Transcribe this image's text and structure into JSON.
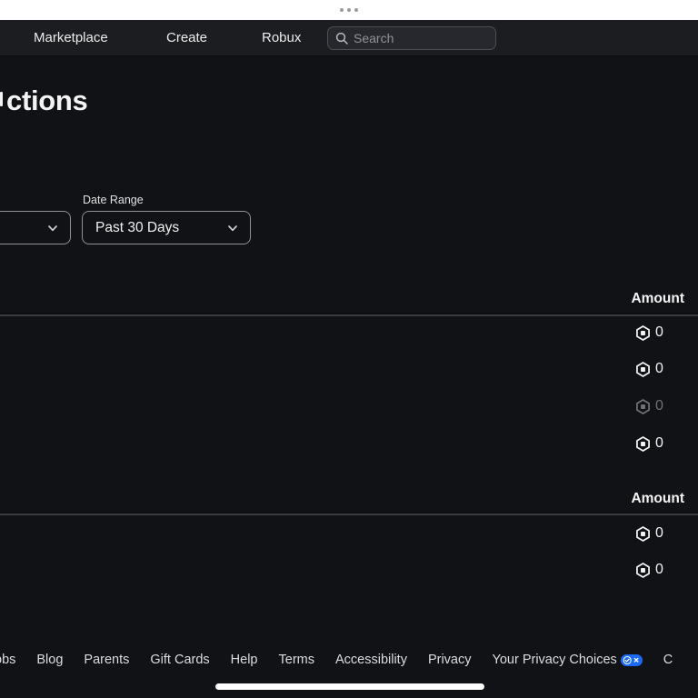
{
  "nav": {
    "items": [
      {
        "label": "Marketplace"
      },
      {
        "label": "Create"
      },
      {
        "label": "Robux"
      }
    ],
    "search": {
      "placeholder": "Search"
    }
  },
  "page": {
    "heading_visible": "ctions"
  },
  "filters": {
    "date_range_label": "Date Range",
    "date_range_value": "Past 30 Days"
  },
  "sections": [
    {
      "amount_header": "Amount",
      "rows": [
        {
          "currency": "robux",
          "amount": "0",
          "dimmed": false
        },
        {
          "currency": "robux",
          "amount": "0",
          "dimmed": false
        },
        {
          "currency": "robux",
          "amount": "0",
          "dimmed": true
        },
        {
          "currency": "robux",
          "amount": "0",
          "dimmed": false
        }
      ]
    },
    {
      "amount_header": "Amount",
      "rows": [
        {
          "currency": "robux",
          "amount": "0",
          "dimmed": false
        },
        {
          "currency": "robux",
          "amount": "0",
          "dimmed": false
        }
      ]
    }
  ],
  "footer": {
    "links": [
      "obs",
      "Blog",
      "Parents",
      "Gift Cards",
      "Help",
      "Terms",
      "Accessibility",
      "Privacy",
      "Your Privacy Choices",
      "C"
    ]
  },
  "colors": {
    "privacy_icon_blue": "#1a6af5",
    "nav_background": "#1b1d21",
    "page_background": "#111215",
    "dimmed_text": "#6f7276"
  }
}
